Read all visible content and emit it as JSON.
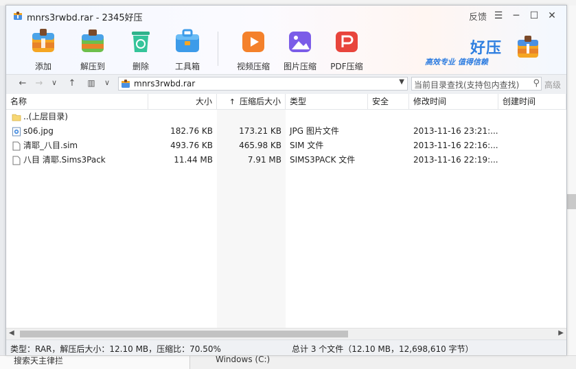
{
  "window": {
    "title": "mnrs3rwbd.rar - 2345好压",
    "feedback": "反馈",
    "menu_icon": "menu-icon",
    "minimize_icon": "minimize-icon",
    "maximize_icon": "maximize-icon",
    "close_icon": "close-icon"
  },
  "toolbar": {
    "items": [
      {
        "label": "添加",
        "icon": "add-icon"
      },
      {
        "label": "解压到",
        "icon": "extract-icon"
      },
      {
        "label": "删除",
        "icon": "delete-icon"
      },
      {
        "label": "工具箱",
        "icon": "toolbox-icon"
      },
      {
        "label": "视频压缩",
        "icon": "video-compress-icon"
      },
      {
        "label": "图片压缩",
        "icon": "image-compress-icon"
      },
      {
        "label": "PDF压缩",
        "icon": "pdf-compress-icon"
      }
    ]
  },
  "brand": {
    "name": "好压",
    "slogan": "高效专业 值得信赖"
  },
  "addressbar": {
    "path": "mnrs3rwbd.rar",
    "search_placeholder": "当前目录查找(支持包内查找)",
    "advanced": "高级"
  },
  "columns": [
    "名称",
    "大小",
    "压缩后大小",
    "类型",
    "安全",
    "修改时间",
    "创建时间"
  ],
  "sort_indicator": "↑",
  "files": [
    {
      "name": "..(上层目录)",
      "size": "",
      "packed": "",
      "type": "",
      "security": "",
      "modified": "",
      "created": "",
      "icon": "folder-icon"
    },
    {
      "name": "s06.jpg",
      "size": "182.76 KB",
      "packed": "173.21 KB",
      "type": "JPG 图片文件",
      "security": "",
      "modified": "2013-11-16 23:21:...",
      "created": "",
      "icon": "image-file-icon"
    },
    {
      "name": "清耶_八目.sim",
      "size": "493.76 KB",
      "packed": "465.98 KB",
      "type": "SIM 文件",
      "security": "",
      "modified": "2013-11-16 22:16:...",
      "created": "",
      "icon": "file-icon"
    },
    {
      "name": "八目 清耶.Sims3Pack",
      "size": "11.44 MB",
      "packed": "7.91 MB",
      "type": "SIMS3PACK 文件",
      "security": "",
      "modified": "2013-11-16 22:19:...",
      "created": "",
      "icon": "file-icon"
    }
  ],
  "status": {
    "left": "类型：RAR，解压后大小：12.10 MB，压缩比：70.50%",
    "right": "总计 3 个文件（12.10 MB，12,698,610 字节）"
  },
  "background": {
    "bottom_left": "搜索天主律拦",
    "bottom_mid": "Windows (C:)"
  },
  "colors": {
    "accent": "#2f7fe0",
    "toolbar_bg": "#f6f8ff"
  }
}
